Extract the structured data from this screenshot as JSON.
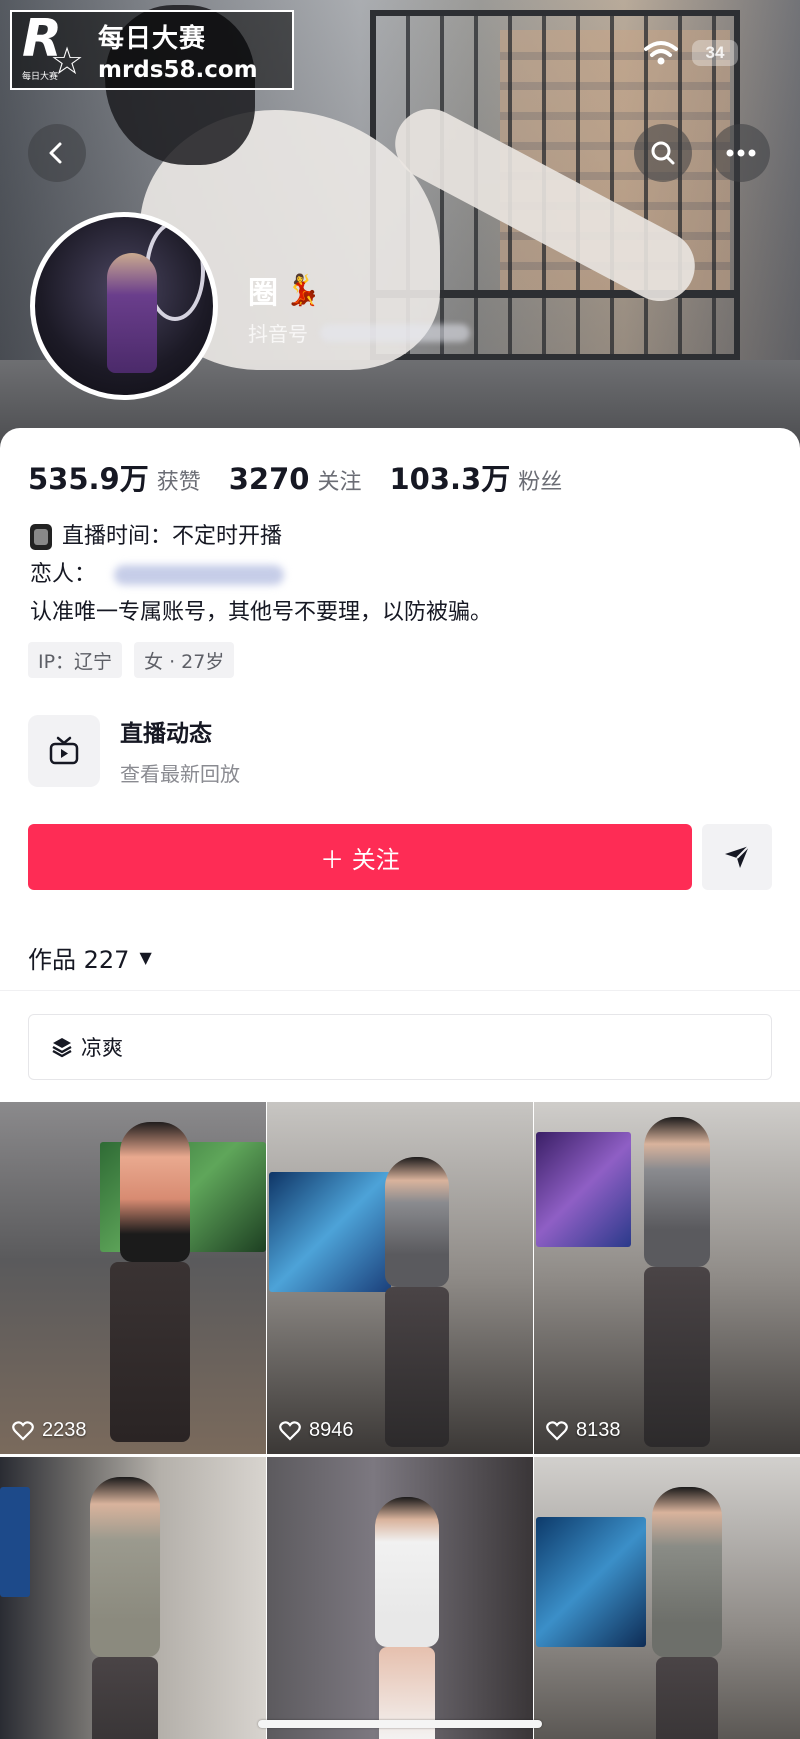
{
  "watermark": {
    "brand_cn": "每日大赛",
    "url": "mrds58.com",
    "logo_text": "R",
    "logo_small": "每日大赛"
  },
  "status_bar": {
    "battery": "34",
    "icons": [
      "wifi-icon",
      "battery-icon"
    ]
  },
  "nav": {
    "back_icon": "back-chevron-icon",
    "search_icon": "search-icon",
    "more_icon": "more-dots-icon"
  },
  "profile": {
    "name": "圈",
    "name_emoji": "💃",
    "douyin_id_label": "抖音号"
  },
  "stats": [
    {
      "value": "535.9万",
      "label": "获赞"
    },
    {
      "value": "3270",
      "label": "关注"
    },
    {
      "value": "103.3万",
      "label": "粉丝"
    }
  ],
  "bio": {
    "live_time": "直播时间：不定时开播",
    "lover_label": "恋人：",
    "notice": "认准唯一专属账号，其他号不要理，以防被骗。"
  },
  "tags": [
    "IP：辽宁",
    "女 · 27岁"
  ],
  "live": {
    "title": "直播动态",
    "subtitle": "查看最新回放"
  },
  "actions": {
    "follow_label": "＋ 关注",
    "share_icon": "send-icon"
  },
  "works": {
    "label": "作品 227",
    "caret": "▼"
  },
  "collection": {
    "label": "凉爽",
    "icon": "layers-icon"
  },
  "videos": [
    {
      "likes": "2238"
    },
    {
      "likes": "8946"
    },
    {
      "likes": "8138"
    },
    {
      "likes": ""
    },
    {
      "likes": ""
    },
    {
      "likes": ""
    }
  ],
  "colors": {
    "primary": "#fe2c55",
    "text": "#161823",
    "muted": "#6b6d75"
  }
}
